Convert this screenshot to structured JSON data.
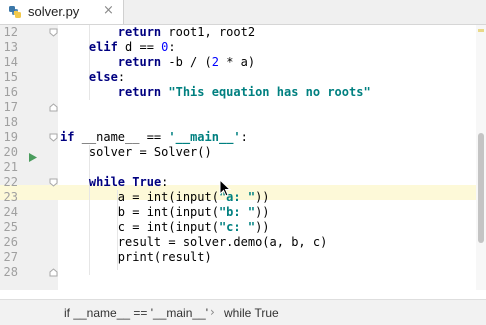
{
  "tab": {
    "filename": "solver.py",
    "close_glyph": "×",
    "icon": "python-file-icon"
  },
  "lines": [
    {
      "n": "12",
      "indent": "        ",
      "segs": [
        {
          "t": "return ",
          "c": "kw"
        },
        {
          "t": "root1, root2",
          "c": ""
        }
      ]
    },
    {
      "n": "13",
      "indent": "    ",
      "segs": [
        {
          "t": "elif ",
          "c": "kw"
        },
        {
          "t": "d == ",
          "c": ""
        },
        {
          "t": "0",
          "c": "num"
        },
        {
          "t": ":",
          "c": ""
        }
      ]
    },
    {
      "n": "14",
      "indent": "        ",
      "segs": [
        {
          "t": "return ",
          "c": "kw"
        },
        {
          "t": "-b / (",
          "c": ""
        },
        {
          "t": "2",
          "c": "num"
        },
        {
          "t": " * a)",
          "c": ""
        }
      ]
    },
    {
      "n": "15",
      "indent": "    ",
      "segs": [
        {
          "t": "else",
          "c": "kw"
        },
        {
          "t": ":",
          "c": ""
        }
      ]
    },
    {
      "n": "16",
      "indent": "        ",
      "segs": [
        {
          "t": "return ",
          "c": "kw"
        },
        {
          "t": "\"This equation has no roots\"",
          "c": "str"
        }
      ]
    },
    {
      "n": "17",
      "indent": "",
      "segs": []
    },
    {
      "n": "18",
      "indent": "",
      "segs": []
    },
    {
      "n": "19",
      "indent": "",
      "segs": [
        {
          "t": "if ",
          "c": "kw"
        },
        {
          "t": "__name__ == ",
          "c": ""
        },
        {
          "t": "'__main__'",
          "c": "str"
        },
        {
          "t": ":",
          "c": ""
        }
      ]
    },
    {
      "n": "20",
      "indent": "    ",
      "segs": [
        {
          "t": "solver = Solver()",
          "c": ""
        }
      ]
    },
    {
      "n": "21",
      "indent": "",
      "segs": []
    },
    {
      "n": "22",
      "indent": "    ",
      "segs": [
        {
          "t": "while ",
          "c": "kw"
        },
        {
          "t": "True",
          "c": "kw"
        },
        {
          "t": ":",
          "c": ""
        }
      ]
    },
    {
      "n": "23",
      "indent": "        ",
      "segs": [
        {
          "t": "a = int(input(",
          "c": ""
        },
        {
          "t": "\"a: \"",
          "c": "str"
        },
        {
          "t": "))",
          "c": ""
        }
      ]
    },
    {
      "n": "24",
      "indent": "        ",
      "segs": [
        {
          "t": "b = int(input(",
          "c": ""
        },
        {
          "t": "\"b: \"",
          "c": "str"
        },
        {
          "t": "))",
          "c": ""
        }
      ]
    },
    {
      "n": "25",
      "indent": "        ",
      "segs": [
        {
          "t": "c = int(input(",
          "c": ""
        },
        {
          "t": "\"c: \"",
          "c": "str"
        },
        {
          "t": "))",
          "c": ""
        }
      ]
    },
    {
      "n": "26",
      "indent": "        ",
      "segs": [
        {
          "t": "result = solver.demo(a, b, c)",
          "c": ""
        }
      ]
    },
    {
      "n": "27",
      "indent": "        ",
      "segs": [
        {
          "t": "print(result)",
          "c": ""
        }
      ]
    },
    {
      "n": "28",
      "indent": "",
      "segs": []
    }
  ],
  "current_line": "23",
  "breadcrumb": {
    "items": [
      "if __name__ == '__main__'",
      "while True"
    ],
    "separator": "›"
  },
  "colors": {
    "keyword": "#000080",
    "string": "#008080",
    "number": "#0000ff",
    "current_line_bg": "#fdf9d8"
  }
}
